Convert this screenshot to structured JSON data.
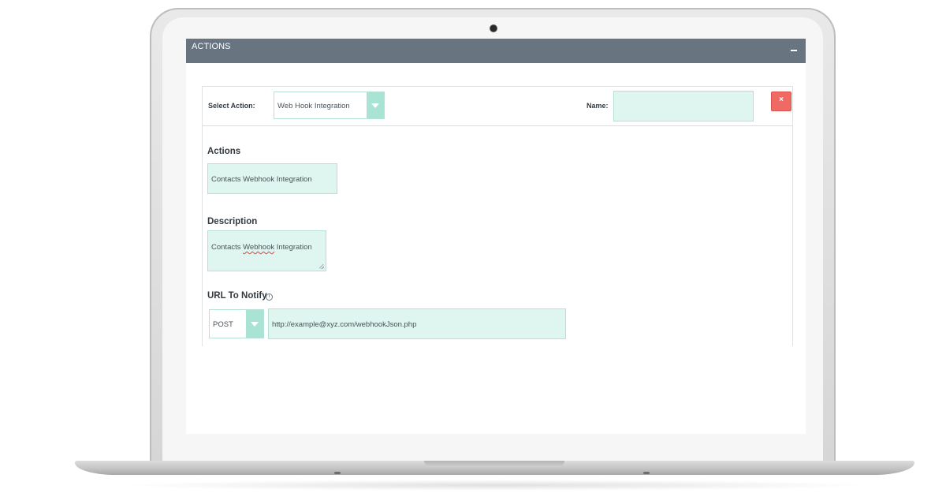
{
  "panel": {
    "title": "ACTIONS",
    "collapse_icon": "minus-icon"
  },
  "action_row": {
    "select_action_label": "Select Action:",
    "select_action_value": "Web Hook Integration",
    "name_label": "Name:",
    "name_value": "",
    "remove_icon": "close-icon",
    "remove_symbol": "×"
  },
  "actions_section": {
    "label": "Actions",
    "value": "Contacts Webhook Integration"
  },
  "description_section": {
    "label": "Description",
    "value_prefix": "Contacts ",
    "value_misspelled": "Webhook",
    "value_suffix": " Integration"
  },
  "url_section": {
    "label": "URL To Notify",
    "info_icon": "info-icon",
    "info_symbol": "i",
    "method_value": "POST",
    "url_value": "http://example@xyz.com/webhookJson.php"
  },
  "colors": {
    "header_bg": "#687580",
    "field_bg": "#dff5ef",
    "field_border": "#b6e2d6",
    "arrow_bg": "#a8e3d3",
    "remove_bg": "#f06a64"
  }
}
